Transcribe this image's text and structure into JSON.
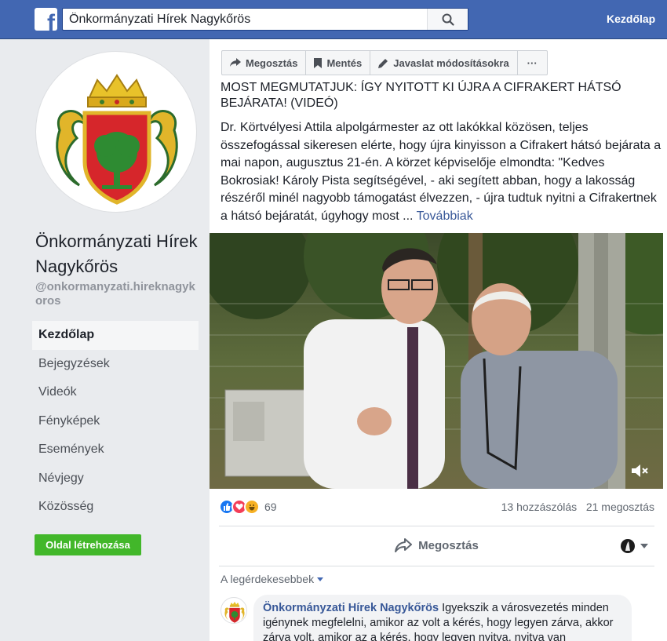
{
  "topbar": {
    "logo": "facebook-f-logo",
    "search_value": "Önkormányzati Hírek Nagykőrös",
    "home_label": "Kezdőlap"
  },
  "page": {
    "name": "Önkormányzati Hírek Nagykőrös",
    "handle": "@onkormanyzati.hireknagykoros"
  },
  "nav": {
    "items": [
      {
        "label": "Kezdőlap",
        "active": true
      },
      {
        "label": "Bejegyzések"
      },
      {
        "label": "Videók"
      },
      {
        "label": "Fényképek"
      },
      {
        "label": "Események"
      },
      {
        "label": "Névjegy"
      },
      {
        "label": "Közösség"
      }
    ],
    "create_page": "Oldal létrehozása"
  },
  "actions": {
    "share": "Megosztás",
    "save": "Mentés",
    "suggest": "Javaslat módosításokra",
    "more": "···"
  },
  "post": {
    "title": "MOST MEGMUTATJUK: ÍGY NYITOTT KI ÚJRA A CIFRAKERT HÁTSÓ BEJÁRATA! (VIDEÓ)",
    "body": "Dr. Körtvélyesi Attila alpolgármester az ott lakókkal közösen, teljes összefogással sikeresen elérte, hogy újra kinyisson a Cifrakert hátsó bejárata a mai napon, augusztus 21-én. A körzet képviselője elmondta: \"Kedves Bokrosiak! Károly Pista segítségével, - aki segített abban, hogy a lakosság részéről minél nagyobb támogatást élvezzen, - újra tudtuk nyitni a Cifrakertnek a hátsó bejáratát, úgyhogy most ...",
    "more": "Továbbiak"
  },
  "stats": {
    "reaction_count": "69",
    "comments": "13 hozzászólás",
    "shares": "21 megosztás"
  },
  "share_row": {
    "label": "Megosztás"
  },
  "comments": {
    "sort_label": "A legérdekesebbek",
    "first": {
      "author": "Önkormányzati Hírek Nagykőrös",
      "text": "Igyekszik a városvezetés minden igénynek megfelelni, amikor az volt a kérés, hogy legyen zárva, akkor zárva volt, amikor az a kérés, hogy legyen nyitva, nyitva van"
    }
  },
  "colors": {
    "brand": "#4267b2",
    "link": "#385898",
    "green_button": "#42b72a",
    "like": "#1877f2",
    "love": "#f33e58",
    "haha": "#f7b125"
  }
}
